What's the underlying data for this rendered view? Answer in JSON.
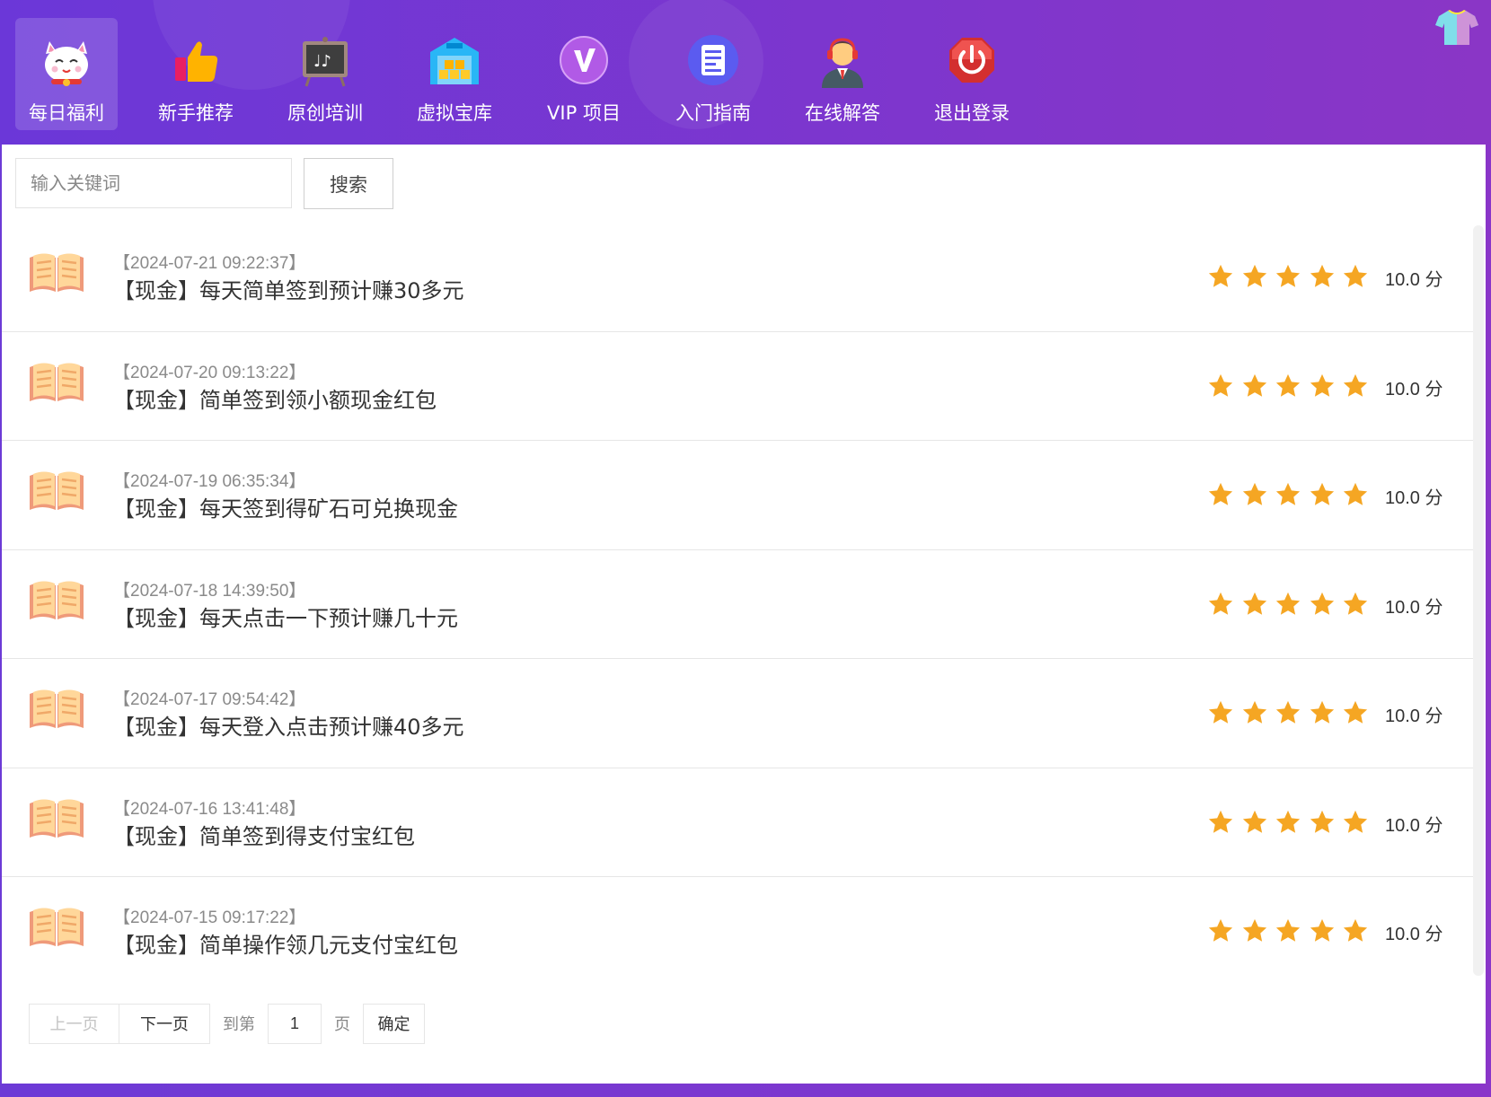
{
  "nav": {
    "items": [
      {
        "label": "每日福利",
        "icon": "lucky-cat-icon",
        "active": true
      },
      {
        "label": "新手推荐",
        "icon": "thumbs-up-icon",
        "active": false
      },
      {
        "label": "原创培训",
        "icon": "music-board-icon",
        "active": false
      },
      {
        "label": "虚拟宝库",
        "icon": "warehouse-icon",
        "active": false
      },
      {
        "label": "VIP 项目",
        "icon": "vip-icon",
        "active": false
      },
      {
        "label": "入门指南",
        "icon": "document-icon",
        "active": false
      },
      {
        "label": "在线解答",
        "icon": "customer-service-icon",
        "active": false
      },
      {
        "label": "退出登录",
        "icon": "power-icon",
        "active": false
      }
    ],
    "right_icon": "tshirt-icon"
  },
  "search": {
    "placeholder": "输入关键词",
    "value": "",
    "button_label": "搜索"
  },
  "list": {
    "items": [
      {
        "date": "【2024-07-21 09:22:37】",
        "title": "【现金】每天简单签到预计赚30多元",
        "rating": 5,
        "score": "10.0 分"
      },
      {
        "date": "【2024-07-20 09:13:22】",
        "title": "【现金】简单签到领小额现金红包",
        "rating": 5,
        "score": "10.0 分"
      },
      {
        "date": "【2024-07-19 06:35:34】",
        "title": "【现金】每天签到得矿石可兑换现金",
        "rating": 5,
        "score": "10.0 分"
      },
      {
        "date": "【2024-07-18 14:39:50】",
        "title": "【现金】每天点击一下预计赚几十元",
        "rating": 5,
        "score": "10.0 分"
      },
      {
        "date": "【2024-07-17 09:54:42】",
        "title": "【现金】每天登入点击预计赚40多元",
        "rating": 5,
        "score": "10.0 分"
      },
      {
        "date": "【2024-07-16 13:41:48】",
        "title": "【现金】简单签到得支付宝红包",
        "rating": 5,
        "score": "10.0 分"
      },
      {
        "date": "【2024-07-15 09:17:22】",
        "title": "【现金】简单操作领几元支付宝红包",
        "rating": 5,
        "score": "10.0 分"
      }
    ],
    "row_icon": "open-book-icon",
    "star_color": "#f5a623"
  },
  "pager": {
    "prev_label": "上一页",
    "next_label": "下一页",
    "goto_label": "到第",
    "page_value": "1",
    "page_suffix": "页",
    "confirm_label": "确定"
  },
  "colors": {
    "header_gradient_start": "#6b37d8",
    "header_gradient_end": "#8a36c6"
  }
}
